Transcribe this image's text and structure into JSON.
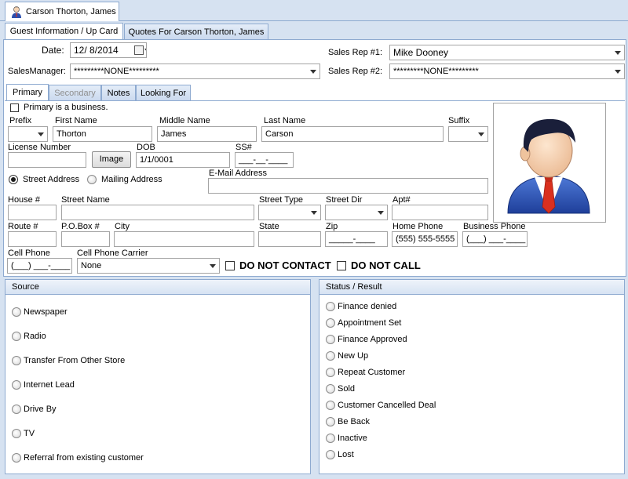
{
  "window_tab": "Carson Thorton, James",
  "top_tabs": [
    "Guest Information / Up Card",
    "Quotes For Carson Thorton, James"
  ],
  "date": {
    "label": "Date:",
    "value": "12/  8/2014"
  },
  "sales_manager": {
    "label": "SalesManager:",
    "value": "*********NONE*********"
  },
  "sales_rep1": {
    "label": "Sales Rep #1:",
    "value": "Mike Dooney"
  },
  "sales_rep2": {
    "label": "Sales Rep #2:",
    "value": "*********NONE*********"
  },
  "sub_tabs": [
    "Primary",
    "Secondary",
    "Notes",
    "Looking For"
  ],
  "primary_business_label": "Primary is a business.",
  "labels": {
    "prefix": "Prefix",
    "first_name": "First Name",
    "middle_name": "Middle Name",
    "last_name": "Last Name",
    "suffix": "Suffix",
    "license": "License Number",
    "dob": "DOB",
    "ssn": "SS#",
    "street_address": "Street Address",
    "mailing_address": "Mailing Address",
    "email": "E-Mail Address",
    "house": "House #",
    "street_name": "Street Name",
    "street_type": "Street Type",
    "street_dir": "Street Dir",
    "apt": "Apt#",
    "route": "Route #",
    "pobox": "P.O.Box #",
    "city": "City",
    "state": "State",
    "zip": "Zip",
    "home_phone": "Home Phone",
    "business_phone": "Business Phone",
    "cell_phone": "Cell Phone",
    "cell_carrier": "Cell Phone Carrier",
    "do_not_contact": "DO NOT CONTACT",
    "do_not_call": "DO NOT CALL"
  },
  "values": {
    "first_name": "Thorton",
    "middle_name": "James",
    "last_name": "Carson",
    "dob": "1/1/0001",
    "ssn": "___-__-____",
    "zip": "_____-____",
    "home_phone": "(555) 555-5555",
    "business_phone": "(___) ___-____",
    "cell_phone": "(___) ___-____",
    "cell_carrier": "None"
  },
  "image_button": "Image",
  "source": {
    "title": "Source",
    "options": [
      "Newspaper",
      "Radio",
      "Transfer From Other Store",
      "Internet Lead",
      "Drive By",
      "TV",
      "Referral from existing customer"
    ]
  },
  "status": {
    "title": "Status / Result",
    "options": [
      "Finance denied",
      "Appointment Set",
      "Finance Approved",
      "New Up",
      "Repeat Customer",
      "Sold",
      "Customer Cancelled Deal",
      "Be Back",
      "Inactive",
      "Lost"
    ]
  },
  "icons": {
    "window_tab": "person-icon",
    "photo": "person-avatar-icon"
  },
  "colors": {
    "accent": "#8eaad0",
    "background": "#d6e2f1",
    "tie": "#d9301f",
    "suit": "#2b4fae"
  }
}
